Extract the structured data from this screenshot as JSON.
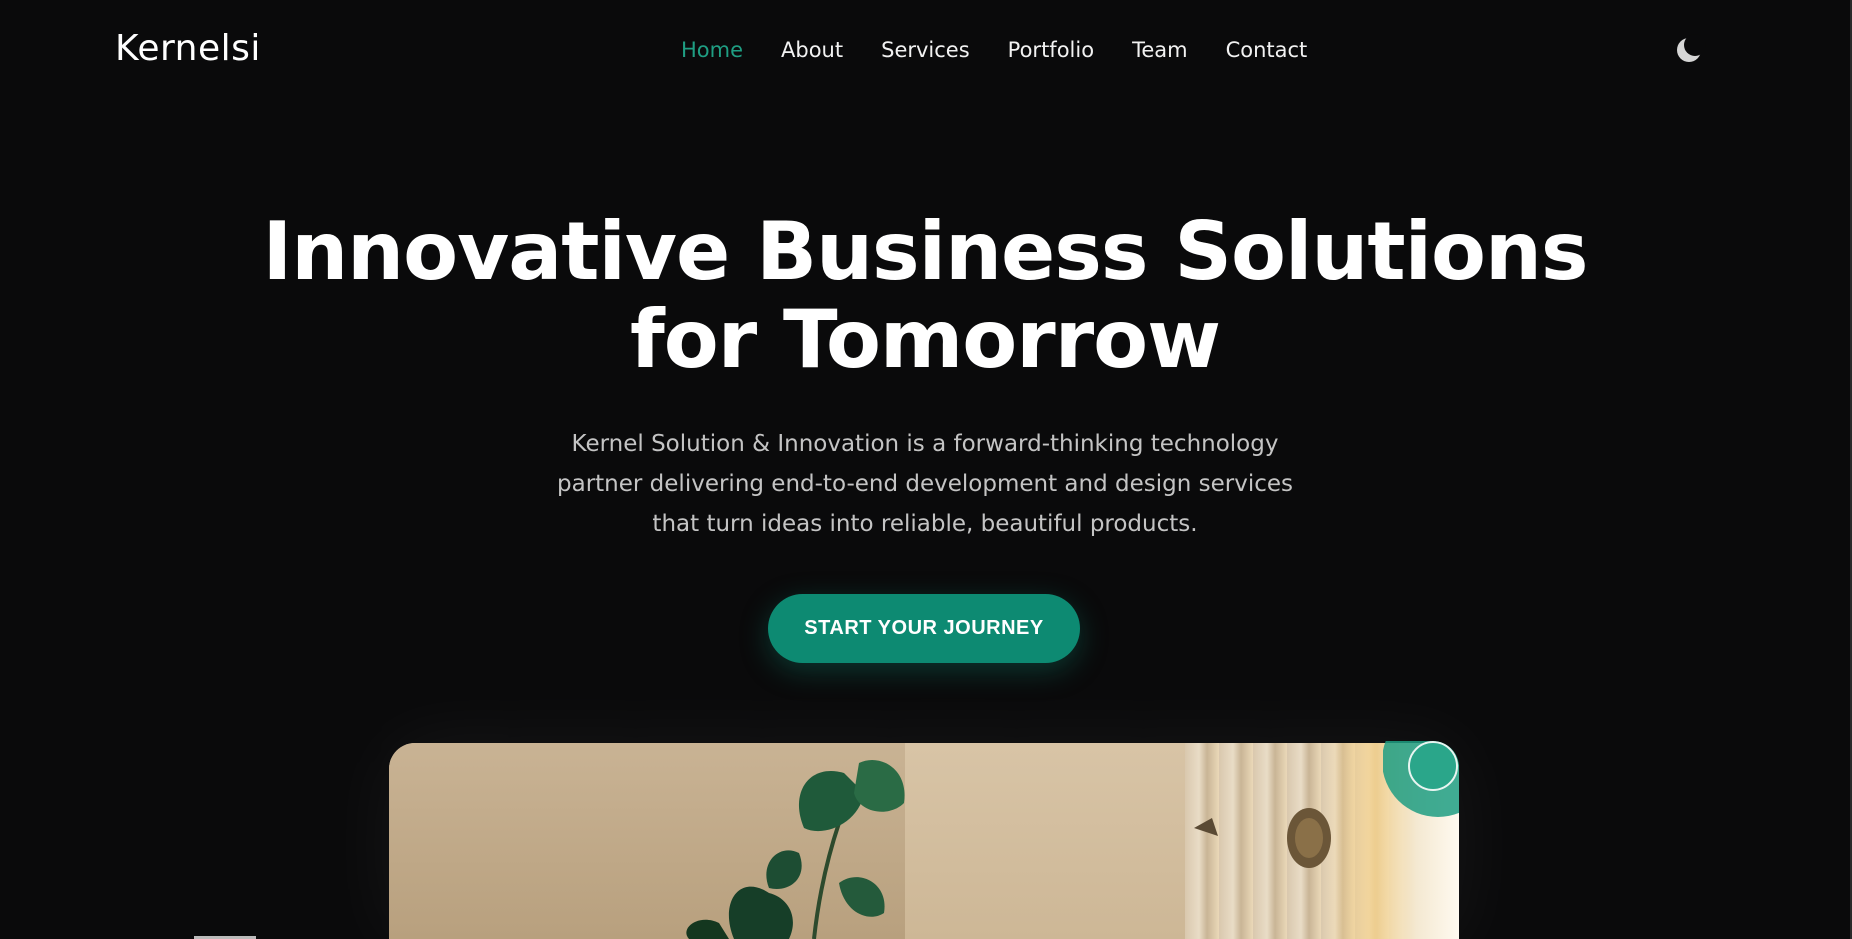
{
  "header": {
    "logo": "Kernelsi",
    "nav": [
      {
        "label": "Home",
        "active": true
      },
      {
        "label": "About",
        "active": false
      },
      {
        "label": "Services",
        "active": false
      },
      {
        "label": "Portfolio",
        "active": false
      },
      {
        "label": "Team",
        "active": false
      },
      {
        "label": "Contact",
        "active": false
      }
    ],
    "theme_toggle_icon": "moon-icon"
  },
  "hero": {
    "title_line1": "Innovative Business Solutions",
    "title_line2": "for Tomorrow",
    "description": "Kernel Solution & Innovation is a forward-thinking technology partner delivering end-to-end development and design services that turn ideas into reliable, beautiful products.",
    "cta_label": "START YOUR JOURNEY"
  },
  "colors": {
    "background": "#0a0a0b",
    "accent": "#0d8a72",
    "nav_active": "#1f9e83"
  }
}
